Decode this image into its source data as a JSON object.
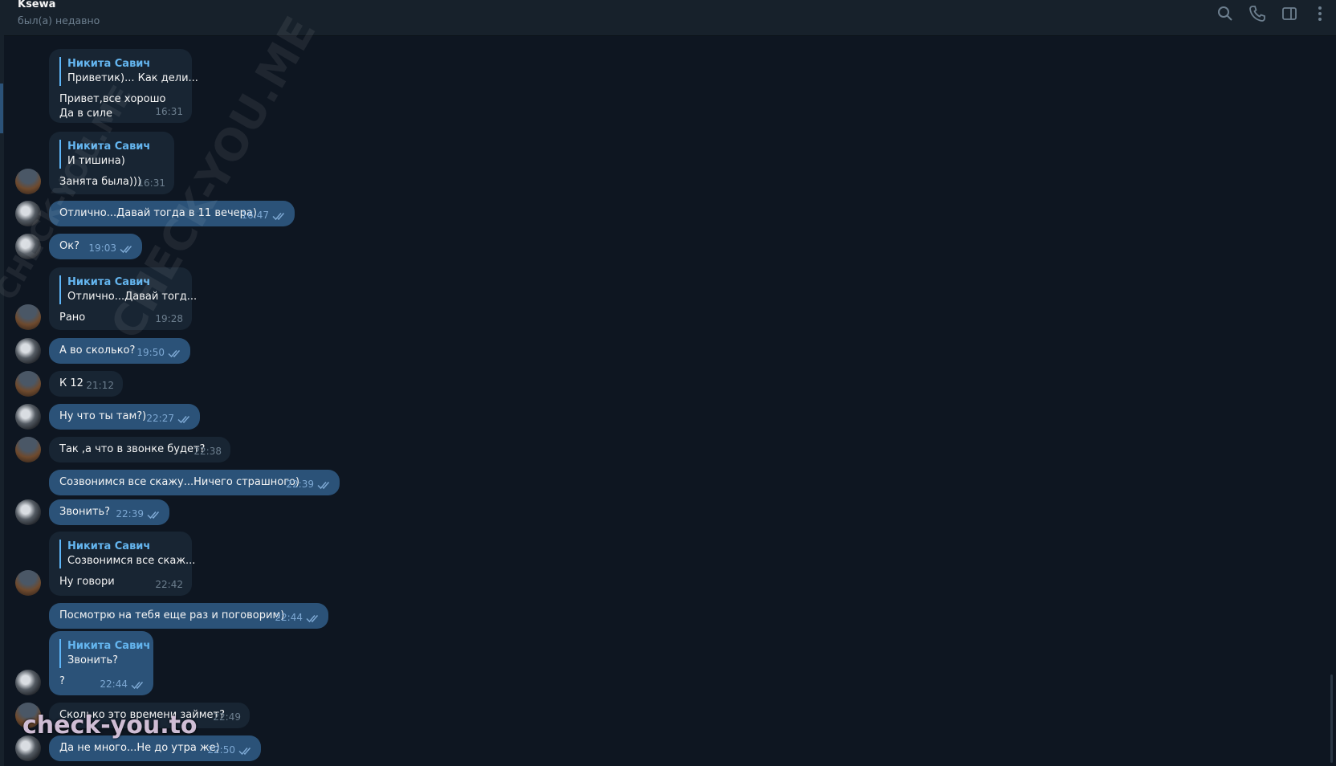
{
  "chat": {
    "name": "Ksewa",
    "status": "был(а) недавно"
  },
  "icons": [
    "search-icon",
    "phone-icon",
    "sidebar-toggle-icon",
    "more-vert-icon"
  ],
  "colors": {
    "out_bubble": "#2b5278",
    "in_bubble": "#182533",
    "accent": "#64b5ef",
    "bg": "#0e1621"
  },
  "messages": [
    {
      "dir": "in",
      "reply": {
        "name": "Никита Савич",
        "text": "Приветик)... Как дели..."
      },
      "lines": [
        "Привет,все хорошо",
        "Да в силе"
      ],
      "time": "16:31"
    },
    {
      "dir": "in",
      "reply": {
        "name": "Никита Савич",
        "text": "И тишина)"
      },
      "lines": [
        "Занята была)))"
      ],
      "time": "16:31"
    },
    {
      "dir": "out",
      "lines": [
        "Отлично...Давай тогда в 11 вечера)"
      ],
      "time": "16:47"
    },
    {
      "dir": "out",
      "lines": [
        "Ок?"
      ],
      "time": "19:03"
    },
    {
      "dir": "in",
      "reply": {
        "name": "Никита Савич",
        "text": "Отлично...Давай тогд..."
      },
      "lines": [
        "Рано"
      ],
      "time": "19:28"
    },
    {
      "dir": "out",
      "lines": [
        "А во сколько?"
      ],
      "time": "19:50"
    },
    {
      "dir": "in",
      "lines": [
        "К 12"
      ],
      "time": "21:12"
    },
    {
      "dir": "out",
      "lines": [
        "Ну что ты там?)"
      ],
      "time": "22:27"
    },
    {
      "dir": "in",
      "lines": [
        "Так ,а что в звонке будет?"
      ],
      "time": "22:38"
    },
    {
      "dir": "out",
      "lines": [
        "Созвонимся все скажу...Ничего страшного)"
      ],
      "time": "22:39"
    },
    {
      "dir": "out",
      "lines": [
        "Звонить?"
      ],
      "time": "22:39"
    },
    {
      "dir": "in",
      "reply": {
        "name": "Никита Савич",
        "text": "Созвонимся все скаж..."
      },
      "lines": [
        "Ну говори"
      ],
      "time": "22:42"
    },
    {
      "dir": "out",
      "lines": [
        "Посмотрю на тебя еще раз и поговорим)"
      ],
      "time": "22:44"
    },
    {
      "dir": "out",
      "reply": {
        "name": "Никита Савич",
        "text": "Звонить?"
      },
      "lines": [
        "?"
      ],
      "time": "22:44"
    },
    {
      "dir": "in",
      "lines": [
        "Сколько это времени займет?"
      ],
      "time": "22:49"
    },
    {
      "dir": "out",
      "lines": [
        "Да не много...Не до утра же)"
      ],
      "time": "22:50"
    }
  ],
  "watermarks": {
    "diagonal": "CHECK-YOU.ME",
    "bottom": "check-you.to"
  }
}
